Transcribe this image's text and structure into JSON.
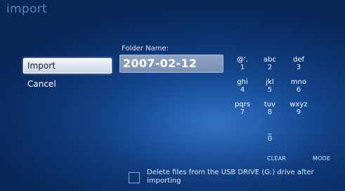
{
  "screen": {
    "title": "import"
  },
  "menu": {
    "items": [
      {
        "label": "Import",
        "selected": true
      },
      {
        "label": "Cancel",
        "selected": false
      }
    ]
  },
  "folder": {
    "label": "Folder Name:",
    "value": "2007-02-12"
  },
  "keypad": {
    "keys": [
      {
        "letters": "@'.",
        "digit": "1"
      },
      {
        "letters": "abc",
        "digit": "2"
      },
      {
        "letters": "def",
        "digit": "3"
      },
      {
        "letters": "ghi",
        "digit": "4"
      },
      {
        "letters": "jkl",
        "digit": "5"
      },
      {
        "letters": "mno",
        "digit": "6"
      },
      {
        "letters": "pqrs",
        "digit": "7"
      },
      {
        "letters": "tuv",
        "digit": "8"
      },
      {
        "letters": "wxyz",
        "digit": "9"
      },
      {
        "letters": "_",
        "digit": "0"
      }
    ],
    "clear_label": "CLEAR",
    "mode_label": "MODE"
  },
  "delete_option": {
    "label": "Delete files from the USB DRIVE (G:) drive after importing",
    "checked": false
  }
}
